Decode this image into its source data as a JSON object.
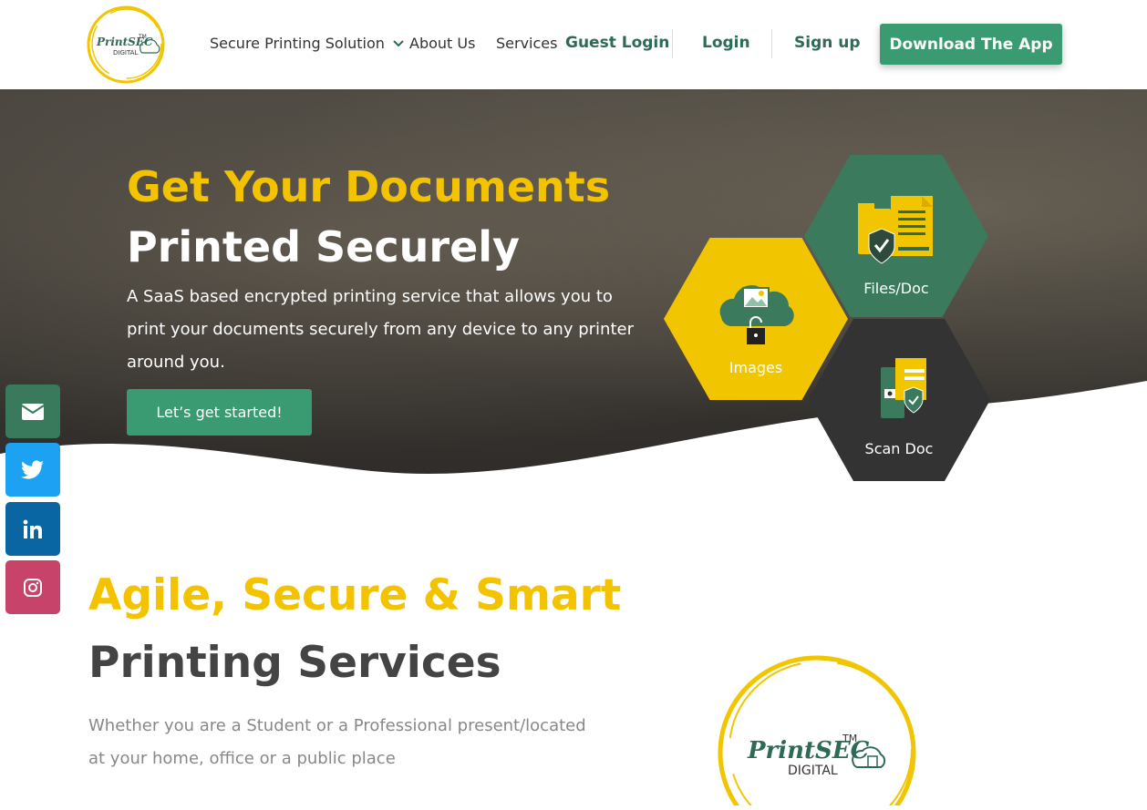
{
  "header": {
    "logo": {
      "brand": "PrintSEC",
      "tm": "TM",
      "sub": "DIGITAL"
    },
    "nav": {
      "secure_printing": "Secure Printing Solution",
      "about": "About Us",
      "services": "Services",
      "guest_login": "Guest Login",
      "login": "Login",
      "signup": "Sign up",
      "download": "Download The App"
    }
  },
  "hero": {
    "title_line1": "Get Your Documents",
    "title_line2": "Printed Securely",
    "description": "A SaaS based encrypted printing service that allows you to print your documents securely from any device to any printer around you.",
    "cta": "Let’s get started!",
    "hexes": {
      "files": "Files/Doc",
      "images": "Images",
      "scan": "Scan Doc"
    }
  },
  "social": [
    "envelope-icon",
    "twitter-icon",
    "linkedin-icon",
    "instagram-icon"
  ],
  "section": {
    "title_line1": "Agile, Secure & Smart",
    "title_line2": "Printing Services",
    "description": "Whether you are a Student or a Professional present/located at your home, office or a public place"
  },
  "colors": {
    "accent_green": "#3a9a72",
    "dark_green": "#2d6b55",
    "yellow": "#f3c300",
    "dark": "#333333"
  }
}
